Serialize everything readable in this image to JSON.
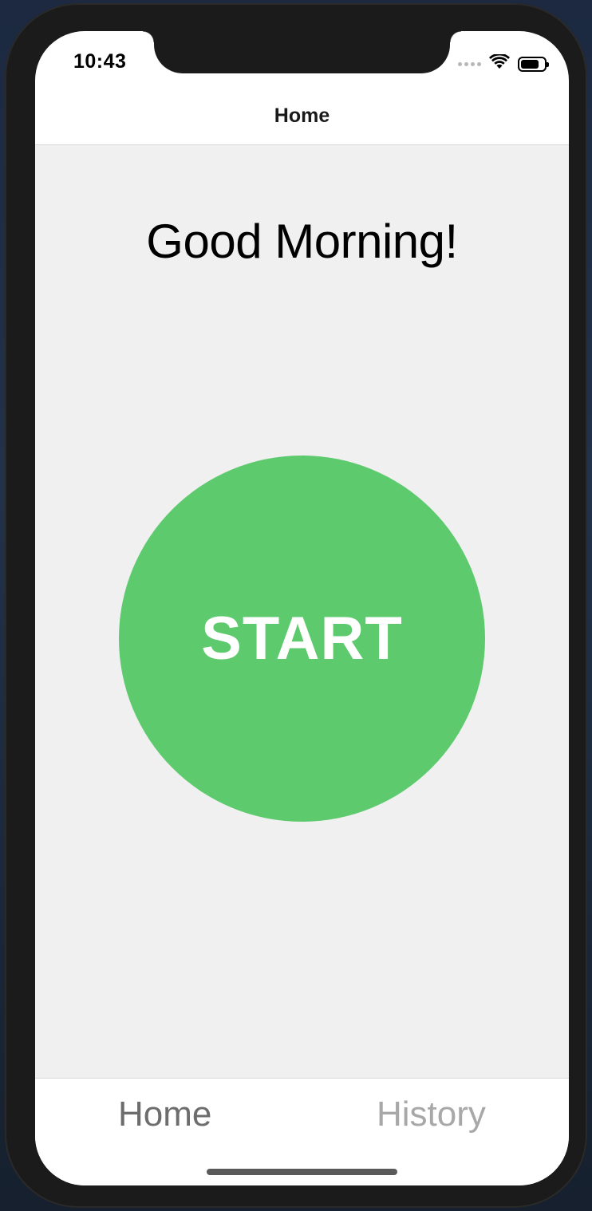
{
  "status_bar": {
    "time": "10:43",
    "icons": [
      "cellular-signal-icon",
      "wifi-icon",
      "battery-icon"
    ]
  },
  "nav_bar": {
    "title": "Home"
  },
  "main": {
    "greeting": "Good Morning!",
    "start_button_label": "START",
    "start_button_color": "#5eca6e"
  },
  "tab_bar": {
    "tabs": [
      {
        "label": "Home",
        "active": true
      },
      {
        "label": "History",
        "active": false
      }
    ]
  },
  "colors": {
    "background": "#f0f0f0",
    "accent": "#5eca6e",
    "tab_active": "#6d6d6d",
    "tab_inactive": "#a8a8a8"
  }
}
